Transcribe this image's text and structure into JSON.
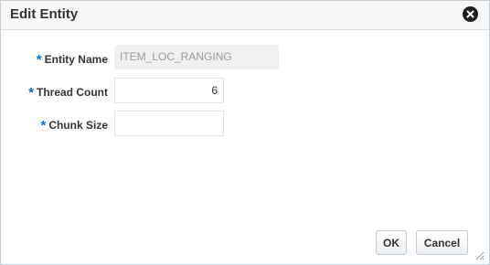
{
  "dialog": {
    "title": "Edit Entity",
    "close_icon": "close-icon"
  },
  "form": {
    "required_marker": "*",
    "entity_name": {
      "label": "Entity Name",
      "value": "ITEM_LOC_RANGING"
    },
    "thread_count": {
      "label": "Thread Count",
      "value": "6"
    },
    "chunk_size": {
      "label": "Chunk Size",
      "value": ""
    }
  },
  "buttons": {
    "ok_label": "OK",
    "cancel_label": "Cancel"
  },
  "colors": {
    "required_marker": "#0572ce",
    "readonly_text": "#9a9a9a",
    "title_bar_bg": "#f7f7f7"
  }
}
